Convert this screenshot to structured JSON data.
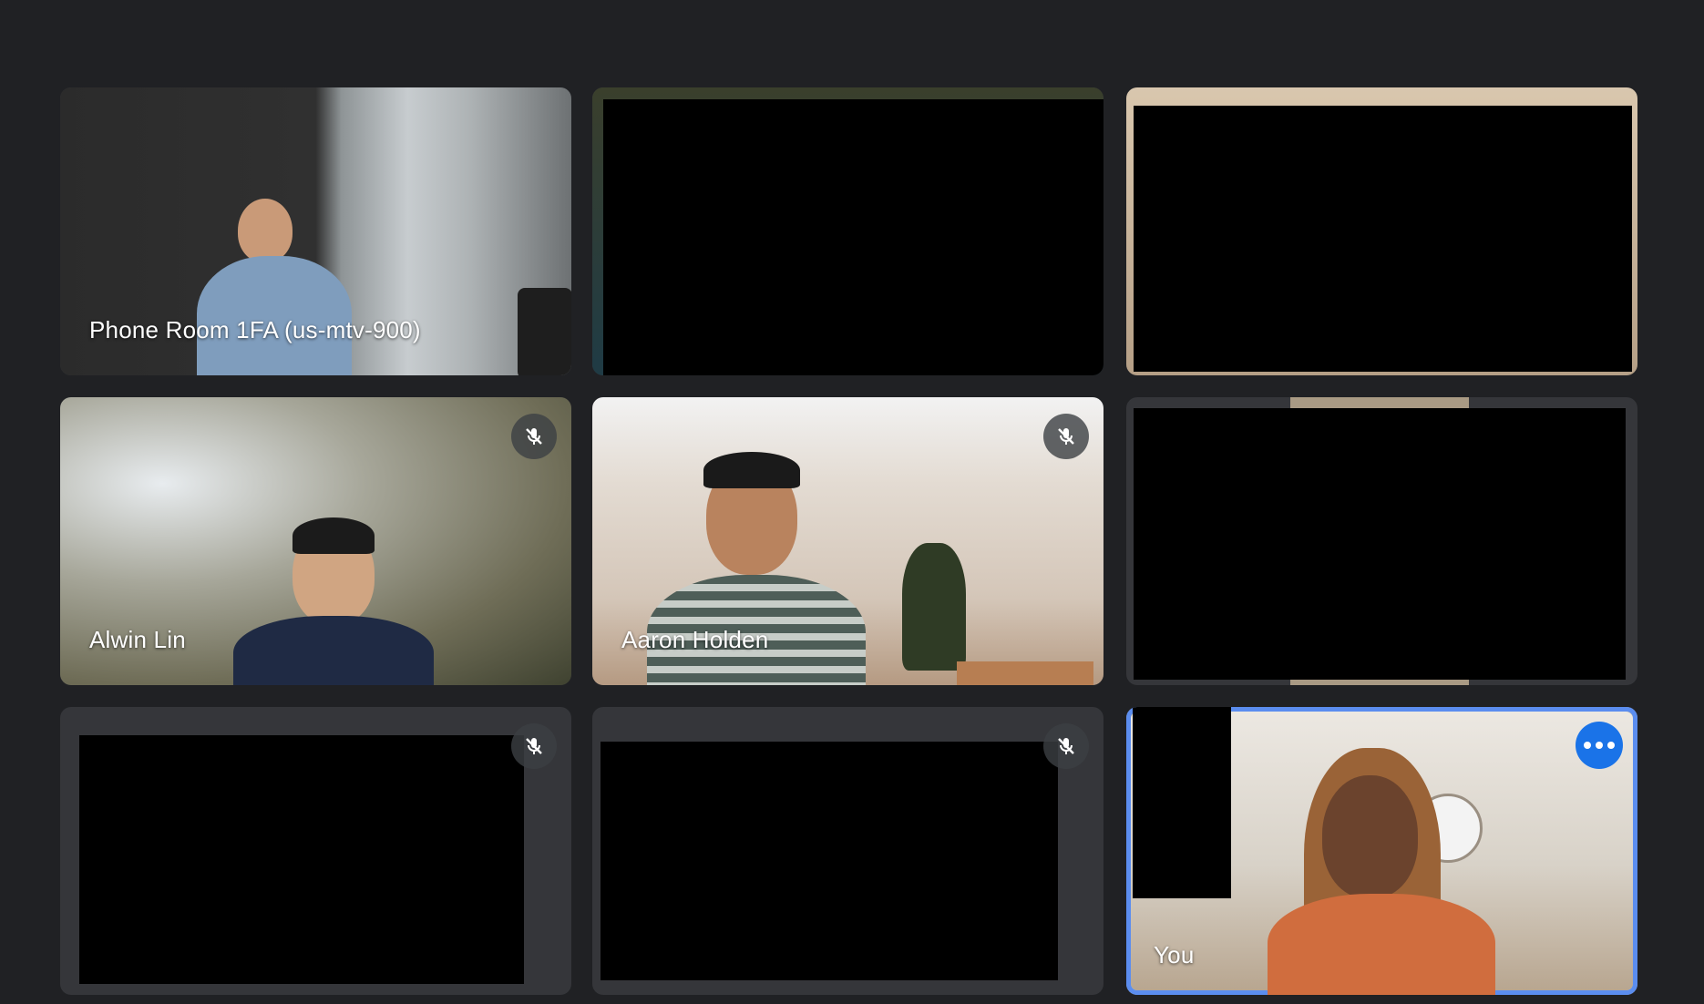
{
  "participants": [
    {
      "name": "Phone Room 1FA (us-mtv-900)",
      "muted": false
    },
    {
      "name": "",
      "muted": false
    },
    {
      "name": "",
      "muted": false
    },
    {
      "name": "Alwin Lin",
      "muted": true
    },
    {
      "name": "Aaron Holden",
      "muted": true
    },
    {
      "name": "",
      "muted": false
    },
    {
      "name": "",
      "muted": true
    },
    {
      "name": "",
      "muted": true
    },
    {
      "name": "You",
      "muted": false,
      "is_self": true
    }
  ],
  "icons": {
    "mute": "mic-off-icon",
    "more": "more-options-icon"
  },
  "colors": {
    "background": "#202124",
    "self_highlight": "#5b8def",
    "more_button": "#1a73e8"
  }
}
